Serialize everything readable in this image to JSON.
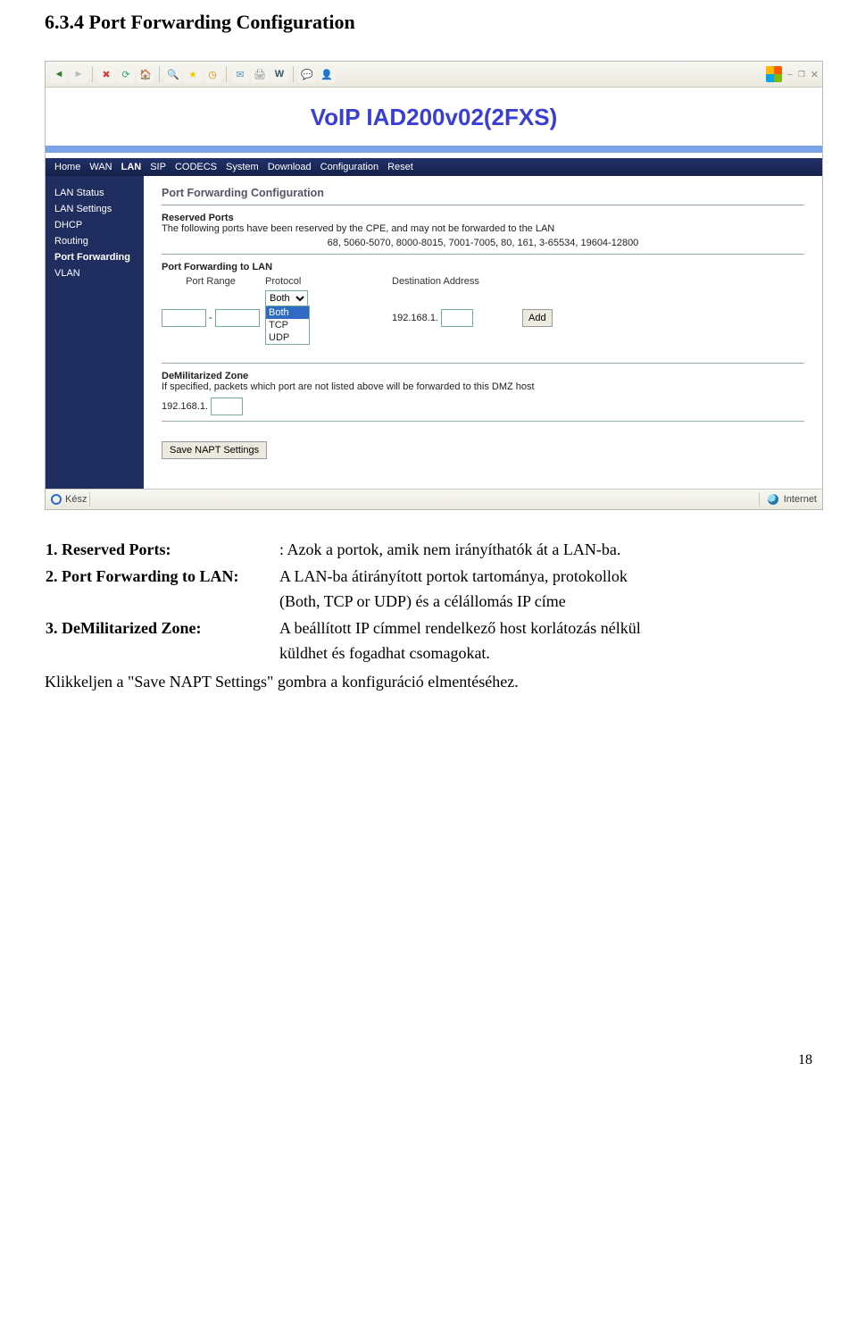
{
  "doc": {
    "section_title": "6.3.4 Port Forwarding Configuration",
    "page_number": "18"
  },
  "browser": {
    "status_left": "Kész",
    "status_right": "Internet"
  },
  "page": {
    "title": "VoIP IAD200v02(2FXS)",
    "nav": {
      "home": "Home",
      "wan": "WAN",
      "lan": "LAN",
      "sip": "SIP",
      "codecs": "CODECS",
      "system": "System",
      "download": "Download",
      "config": "Configuration",
      "reset": "Reset"
    },
    "side": {
      "lans": "LAN Status",
      "lset": "LAN Settings",
      "dhcp": "DHCP",
      "routing": "Routing",
      "pf": "Port Forwarding",
      "vlan": "VLAN"
    },
    "main": {
      "heading": "Port Forwarding Configuration",
      "reserved_title": "Reserved Ports",
      "reserved_text": "The following ports have been reserved by the CPE, and may not be forwarded to the LAN",
      "reserved_ports": "68, 5060-5070, 8000-8015, 7001-7005, 80, 161, 3-65534, 19604-12800",
      "pf_title": "Port Forwarding to LAN",
      "col_portrange": "Port Range",
      "col_protocol": "Protocol",
      "col_dest": "Destination Address",
      "dest_prefix": "192.168.1.",
      "add": "Add",
      "proto_both": "Both",
      "proto_tcp": "TCP",
      "proto_udp": "UDP",
      "dmz_title": "DeMilitarized Zone",
      "dmz_text": "If specified, packets which port are not listed above will be forwarded to this DMZ host",
      "dmz_prefix": "192.168.1.",
      "save": "Save NAPT Settings"
    }
  },
  "explain": {
    "l1_label": "1. Reserved Ports:",
    "l1_text": ": Azok a portok, amik nem irányíthatók át a LAN-ba.",
    "l2_label": "2. Port Forwarding to LAN:",
    "l2_text_a": "A LAN-ba átirányított portok tartománya, protokollok",
    "l2_text_b": "(Both, TCP or UDP) és a célállomás IP címe",
    "l3_label": "3. DeMilitarized Zone:",
    "l3_text_a": "A beállított IP címmel rendelkező host korlátozás nélkül",
    "l3_text_b": "küldhet és fogadhat csomagokat.",
    "end": "Klikkeljen a \"Save NAPT Settings\" gombra a konfiguráció elmentéséhez."
  }
}
